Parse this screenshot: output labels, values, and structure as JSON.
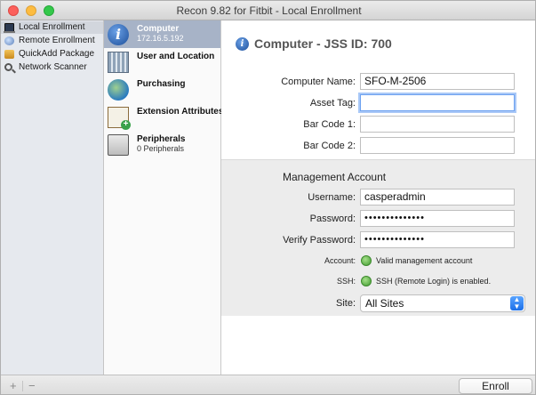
{
  "window": {
    "title": "Recon 9.82 for Fitbit - Local Enrollment"
  },
  "sidebar": {
    "items": [
      {
        "label": "Local Enrollment",
        "icon": "laptop-icon",
        "selected": true
      },
      {
        "label": "Remote Enrollment",
        "icon": "remote-enrollment-icon",
        "selected": false
      },
      {
        "label": "QuickAdd Package",
        "icon": "package-icon",
        "selected": false
      },
      {
        "label": "Network Scanner",
        "icon": "magnifier-icon",
        "selected": false
      }
    ]
  },
  "categories": {
    "items": [
      {
        "label": "Computer",
        "sub": "172.16.5.192",
        "icon": "info-icon",
        "selected": true
      },
      {
        "label": "User and Location",
        "sub": "",
        "icon": "building-icon",
        "selected": false
      },
      {
        "label": "Purchasing",
        "sub": "",
        "icon": "globe-icon",
        "selected": false
      },
      {
        "label": "Extension Attributes",
        "sub": "",
        "icon": "document-add-icon",
        "selected": false
      },
      {
        "label": "Peripherals",
        "sub": "0 Peripherals",
        "icon": "printer-icon",
        "selected": false
      }
    ]
  },
  "detail": {
    "header_title": "Computer - JSS ID: 700",
    "info_glyph": "i",
    "fields": {
      "computer_name": {
        "label": "Computer Name:",
        "value": "SFO-M-2506"
      },
      "asset_tag": {
        "label": "Asset Tag:",
        "value": ""
      },
      "bar_code_1": {
        "label": "Bar Code 1:",
        "value": ""
      },
      "bar_code_2": {
        "label": "Bar Code 2:",
        "value": ""
      }
    },
    "management": {
      "title": "Management Account",
      "username": {
        "label": "Username:",
        "value": "casperadmin"
      },
      "password": {
        "label": "Password:",
        "value": "••••••••••••••"
      },
      "verify_password": {
        "label": "Verify Password:",
        "value": "••••••••••••••"
      },
      "account_status": {
        "label": "Account:",
        "text": "Valid management account",
        "color": "#4caf3a"
      },
      "ssh_status": {
        "label": "SSH:",
        "text": "SSH (Remote Login) is enabled.",
        "color": "#4caf3a"
      },
      "site": {
        "label": "Site:",
        "value": "All Sites"
      }
    }
  },
  "bottom": {
    "add_label": "+",
    "remove_label": "−",
    "enroll_label": "Enroll"
  },
  "colors": {
    "selection": "#a7b3c7",
    "focus_ring": "#6ca1f0",
    "select_arrows": "#1c6fe8"
  }
}
